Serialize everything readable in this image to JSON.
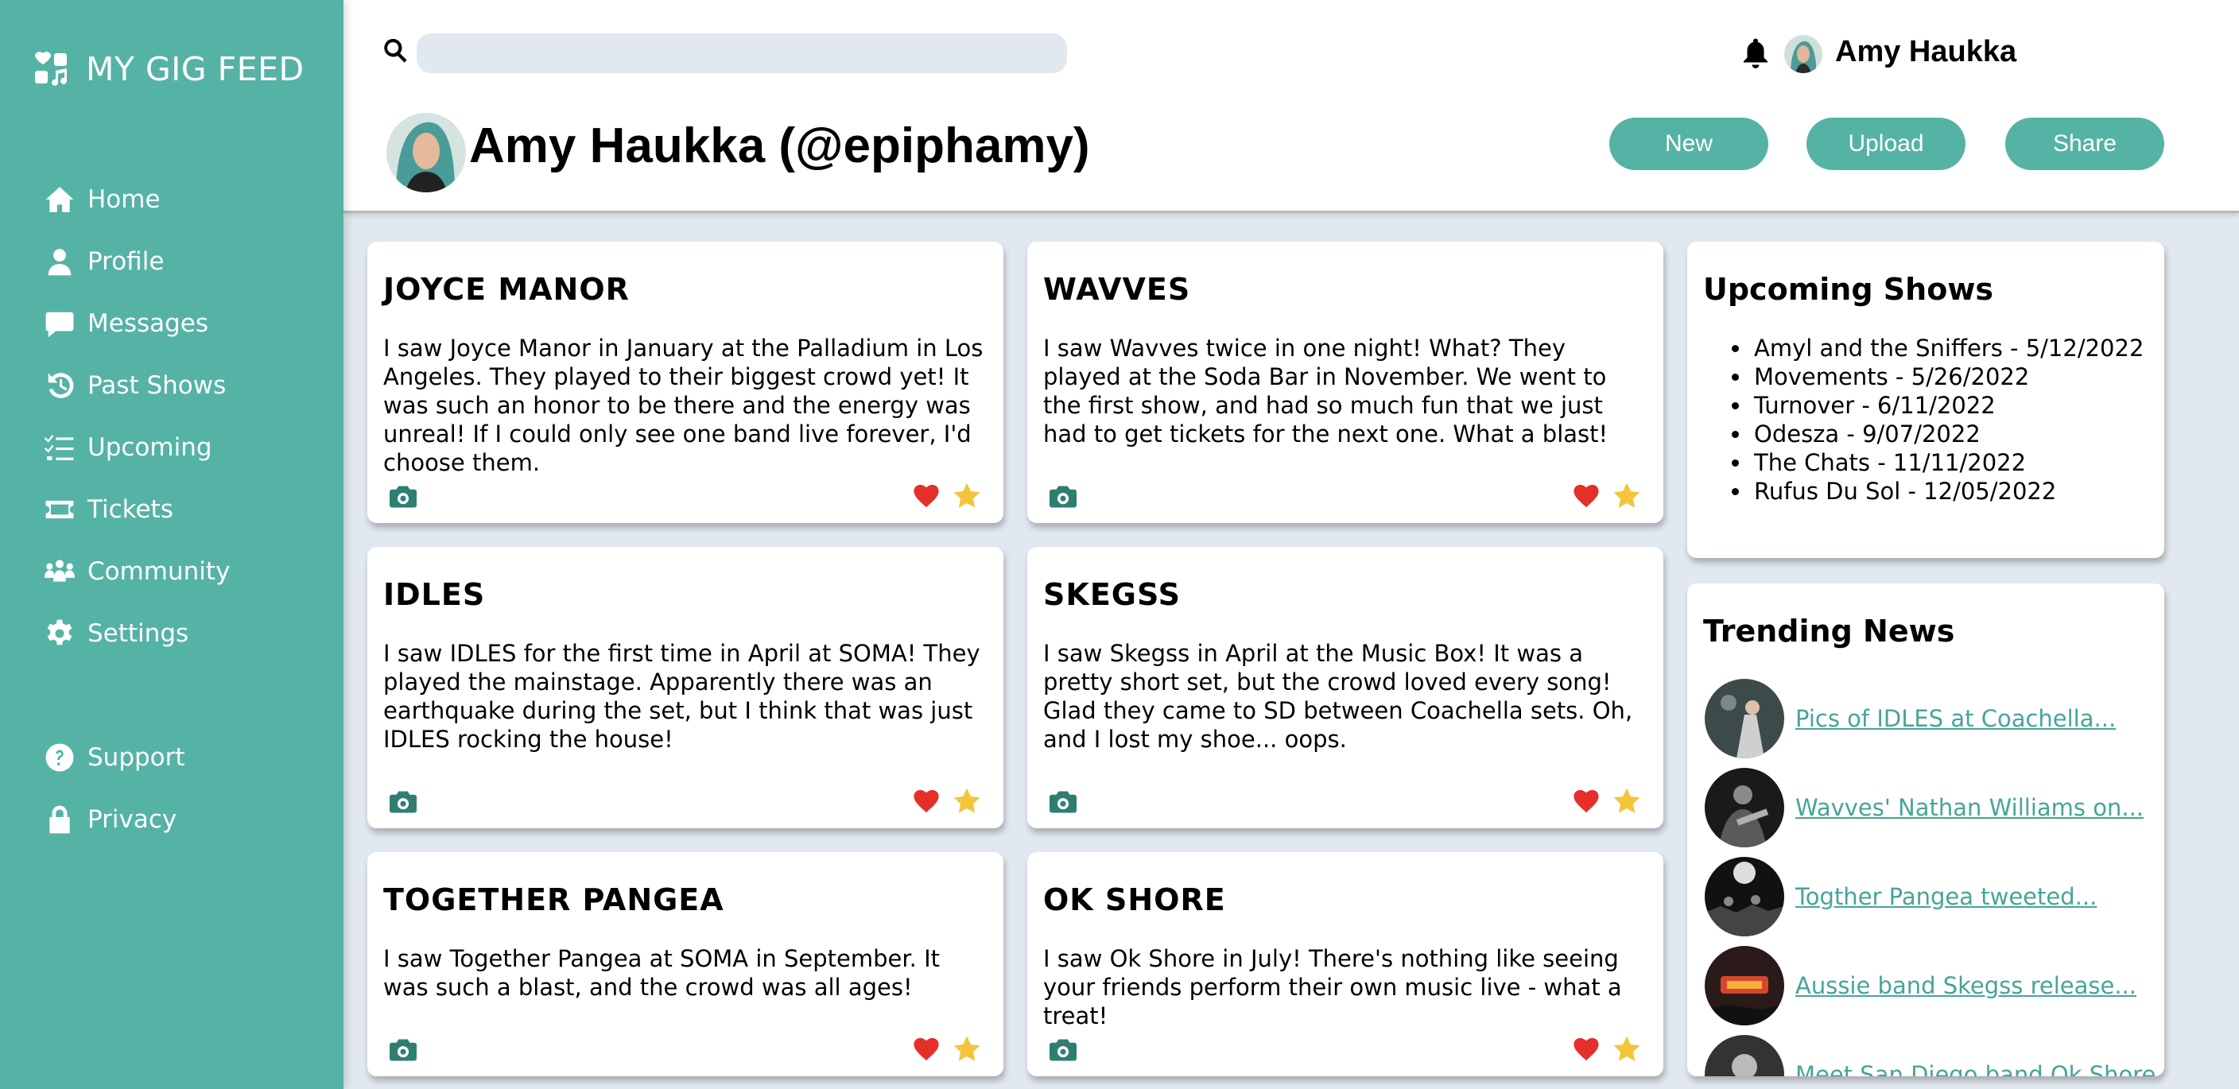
{
  "app": {
    "name": "MY GIG FEED"
  },
  "colors": {
    "accent": "#55b3a5",
    "background": "#e2e8f0",
    "heart": "#e5302a",
    "star": "#f4c53b",
    "camera": "#2e7e71"
  },
  "nav": [
    {
      "label": "Home",
      "icon": "home-icon"
    },
    {
      "label": "Profile",
      "icon": "user-icon"
    },
    {
      "label": "Messages",
      "icon": "message-icon"
    },
    {
      "label": "Past Shows",
      "icon": "history-icon"
    },
    {
      "label": "Upcoming",
      "icon": "list-check-icon"
    },
    {
      "label": "Tickets",
      "icon": "ticket-icon"
    },
    {
      "label": "Community",
      "icon": "people-icon"
    },
    {
      "label": "Settings",
      "icon": "gear-icon"
    },
    {
      "label": "Support",
      "icon": "question-icon"
    },
    {
      "label": "Privacy",
      "icon": "lock-icon"
    }
  ],
  "header": {
    "search": {
      "placeholder": "",
      "value": ""
    },
    "user_name": "Amy Haukka",
    "profile_title": "Amy Haukka (@epiphamy)",
    "buttons": {
      "new": "New",
      "upload": "Upload",
      "share": "Share"
    }
  },
  "posts": [
    {
      "title": "JOYCE MANOR",
      "body": "I saw Joyce Manor in January at the Palladium in Los Angeles. They played to their biggest crowd yet! It was such an honor to be there and the energy was unreal! If I could only see one band live forever, I'd choose them."
    },
    {
      "title": "WAVVES",
      "body": "I saw Wavves twice in one night! What? They played at the Soda Bar in November. We went to the first show, and had so much fun that we just had to get tickets for the next one. What a blast!"
    },
    {
      "title": "IDLES",
      "body": "I saw IDLES for the first time in April at SOMA! They played the mainstage. Apparently there was an earthquake during the set, but I think that was just IDLES rocking the house!"
    },
    {
      "title": "SKEGSS",
      "body": "I saw Skegss in April at the Music Box! It was a pretty short set, but the crowd loved every song! Glad they came to SD between Coachella sets. Oh, and I lost my shoe... oops."
    },
    {
      "title": "TOGETHER PANGEA",
      "body": "I saw Together Pangea at SOMA in September. It was such a blast, and the crowd was all ages!"
    },
    {
      "title": "OK SHORE",
      "body": "I saw Ok Shore in July! There's nothing like seeing your friends perform their own music live - what a treat!"
    }
  ],
  "upcoming": {
    "title": "Upcoming Shows",
    "shows": [
      "Amyl and the Sniffers - 5/12/2022",
      "Movements - 5/26/2022",
      "Turnover - 6/11/2022",
      "Odesza - 9/07/2022",
      "The Chats - 11/11/2022",
      "Rufus Du Sol - 12/05/2022"
    ]
  },
  "news": {
    "title": "Trending News",
    "items": [
      "Pics of IDLES at Coachella...",
      "Wavves' Nathan Williams on...",
      "Togther Pangea tweeted...",
      "Aussie band Skegss release...",
      "Meet San Diego band Ok Shore..."
    ]
  }
}
